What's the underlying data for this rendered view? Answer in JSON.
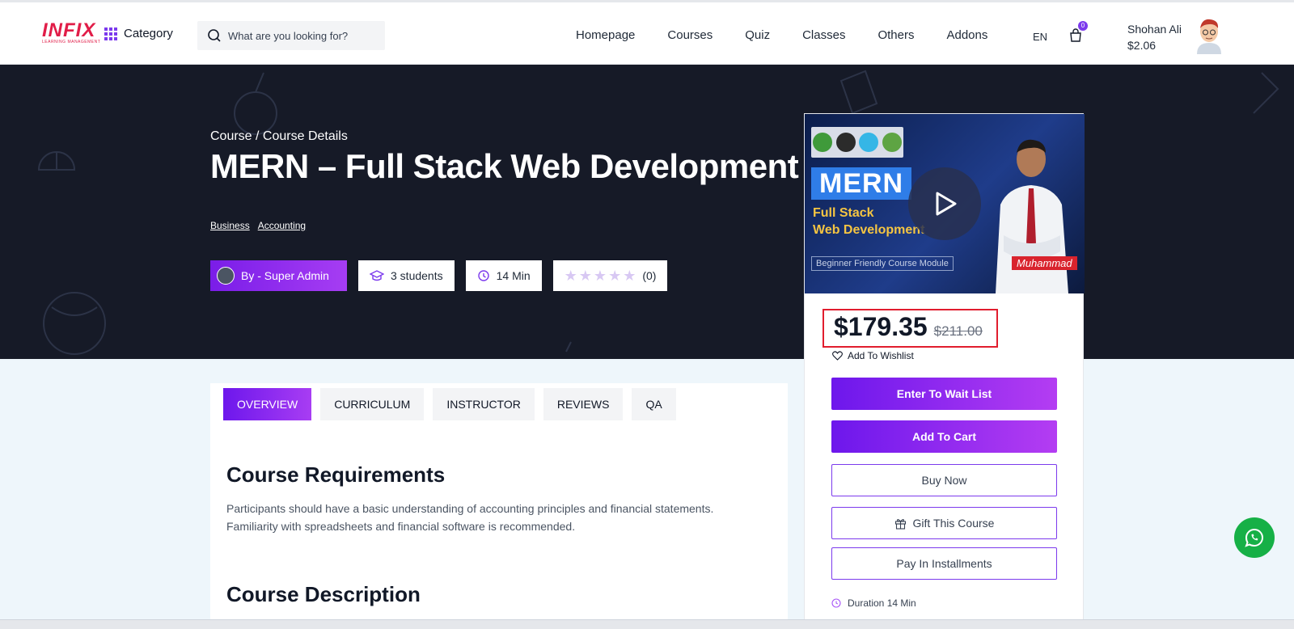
{
  "header": {
    "logo_text": "INFIX",
    "logo_subtext": "LEARNING MANAGEMENT",
    "category_label": "Category",
    "search_placeholder": "What are you looking for?",
    "nav": [
      "Homepage",
      "Courses",
      "Quiz",
      "Classes",
      "Others",
      "Addons"
    ],
    "lang": "EN",
    "cart_count": "0",
    "user_name": "Shohan Ali",
    "user_balance": "$2.06"
  },
  "hero": {
    "breadcrumb": "Course / Course Details",
    "title": "MERN – Full Stack Web Development",
    "tags": [
      "Business",
      "Accounting"
    ],
    "author": "By - Super Admin",
    "students": "3 students",
    "duration": "14 Min",
    "rating_count": "(0)",
    "rating": 0,
    "rating_max": 5
  },
  "thumbnail": {
    "badge": "MERN",
    "line1": "Full Stack",
    "line2": "Web Development",
    "module": "Beginner Friendly Course Module",
    "signature": "Muhammad"
  },
  "purchase": {
    "price": "$179.35",
    "old_price": "$211.00",
    "wishlist": "Add To Wishlist",
    "wait_list": "Enter To Wait List",
    "add_to_cart": "Add To Cart",
    "buy_now": "Buy Now",
    "gift": "Gift This Course",
    "installments": "Pay In Installments",
    "duration": "Duration 14 Min"
  },
  "tabs": [
    "OVERVIEW",
    "CURRICULUM",
    "INSTRUCTOR",
    "REVIEWS",
    "QA"
  ],
  "content": {
    "req_heading": "Course Requirements",
    "req_line1": "Participants should have a basic understanding of accounting principles and financial statements.",
    "req_line2": "Familiarity with spreadsheets and financial software is recommended.",
    "desc_heading": "Course Description"
  },
  "colors": {
    "accent": "#7c3aed",
    "hero_bg": "#161a27",
    "price_highlight": "#e11d2e",
    "whatsapp": "#16b046"
  }
}
